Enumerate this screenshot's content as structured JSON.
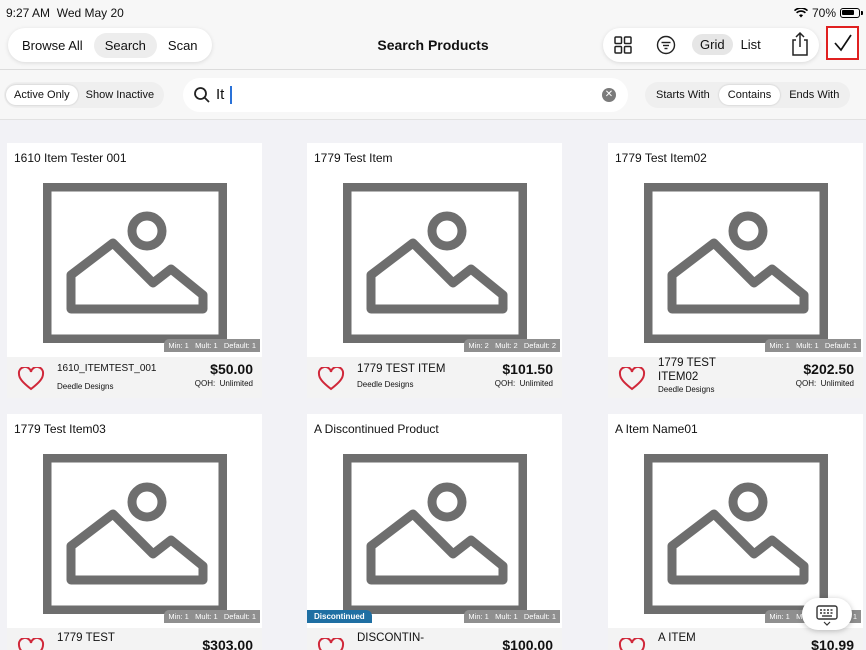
{
  "status": {
    "time": "9:27 AM",
    "date": "Wed May 20",
    "battery": "70%"
  },
  "nav": {
    "segments": [
      "Browse All",
      "Search",
      "Scan"
    ],
    "selected": "Search",
    "title": "Search Products",
    "view_options": [
      "Grid",
      "List"
    ],
    "view_selected": "Grid"
  },
  "filters": {
    "active_options": [
      "Active Only",
      "Show Inactive"
    ],
    "search_query": "It",
    "match_options": [
      "Starts With",
      "Contains",
      "Ends With"
    ]
  },
  "products": [
    {
      "title": "1610 Item Tester 001",
      "sku": "1610_ITEMTEST_001",
      "vendor": "Deedle Designs",
      "price": "$50.00",
      "qoh_label": "QOH:",
      "qoh": "Unlimited",
      "min": "Min: 1",
      "mult": "Mult: 1",
      "default": "Default: 1"
    },
    {
      "title": "1779 Test Item",
      "sku": "1779 TEST ITEM",
      "vendor": "Deedle Designs",
      "price": "$101.50",
      "qoh_label": "QOH:",
      "qoh": "Unlimited",
      "min": "Min: 2",
      "mult": "Mult: 2",
      "default": "Default: 2"
    },
    {
      "title": "1779 Test Item02",
      "sku_line1": "1779 TEST",
      "sku_line2": "ITEM02",
      "vendor": "Deedle Designs",
      "price": "$202.50",
      "qoh_label": "QOH:",
      "qoh": "Unlimited",
      "min": "Min: 1",
      "mult": "Mult: 1",
      "default": "Default: 1"
    },
    {
      "title": "1779 Test Item03",
      "sku_line1": "1779 TEST",
      "price": "$303.00",
      "min": "Min: 1",
      "mult": "Mult: 1",
      "default": "Default: 1"
    },
    {
      "title": "A Discontinued Product",
      "sku_line1": "DISCONTIN-",
      "price": "$100.00",
      "badge": "Discontinued",
      "min": "Min: 1",
      "mult": "Mult: 1",
      "default": "Default: 1"
    },
    {
      "title": "A Item Name01",
      "sku_line1": "A ITEM",
      "price": "$10.99",
      "min": "Min: 1",
      "mult": "Mult: 1",
      "default": "Default: 1"
    }
  ]
}
